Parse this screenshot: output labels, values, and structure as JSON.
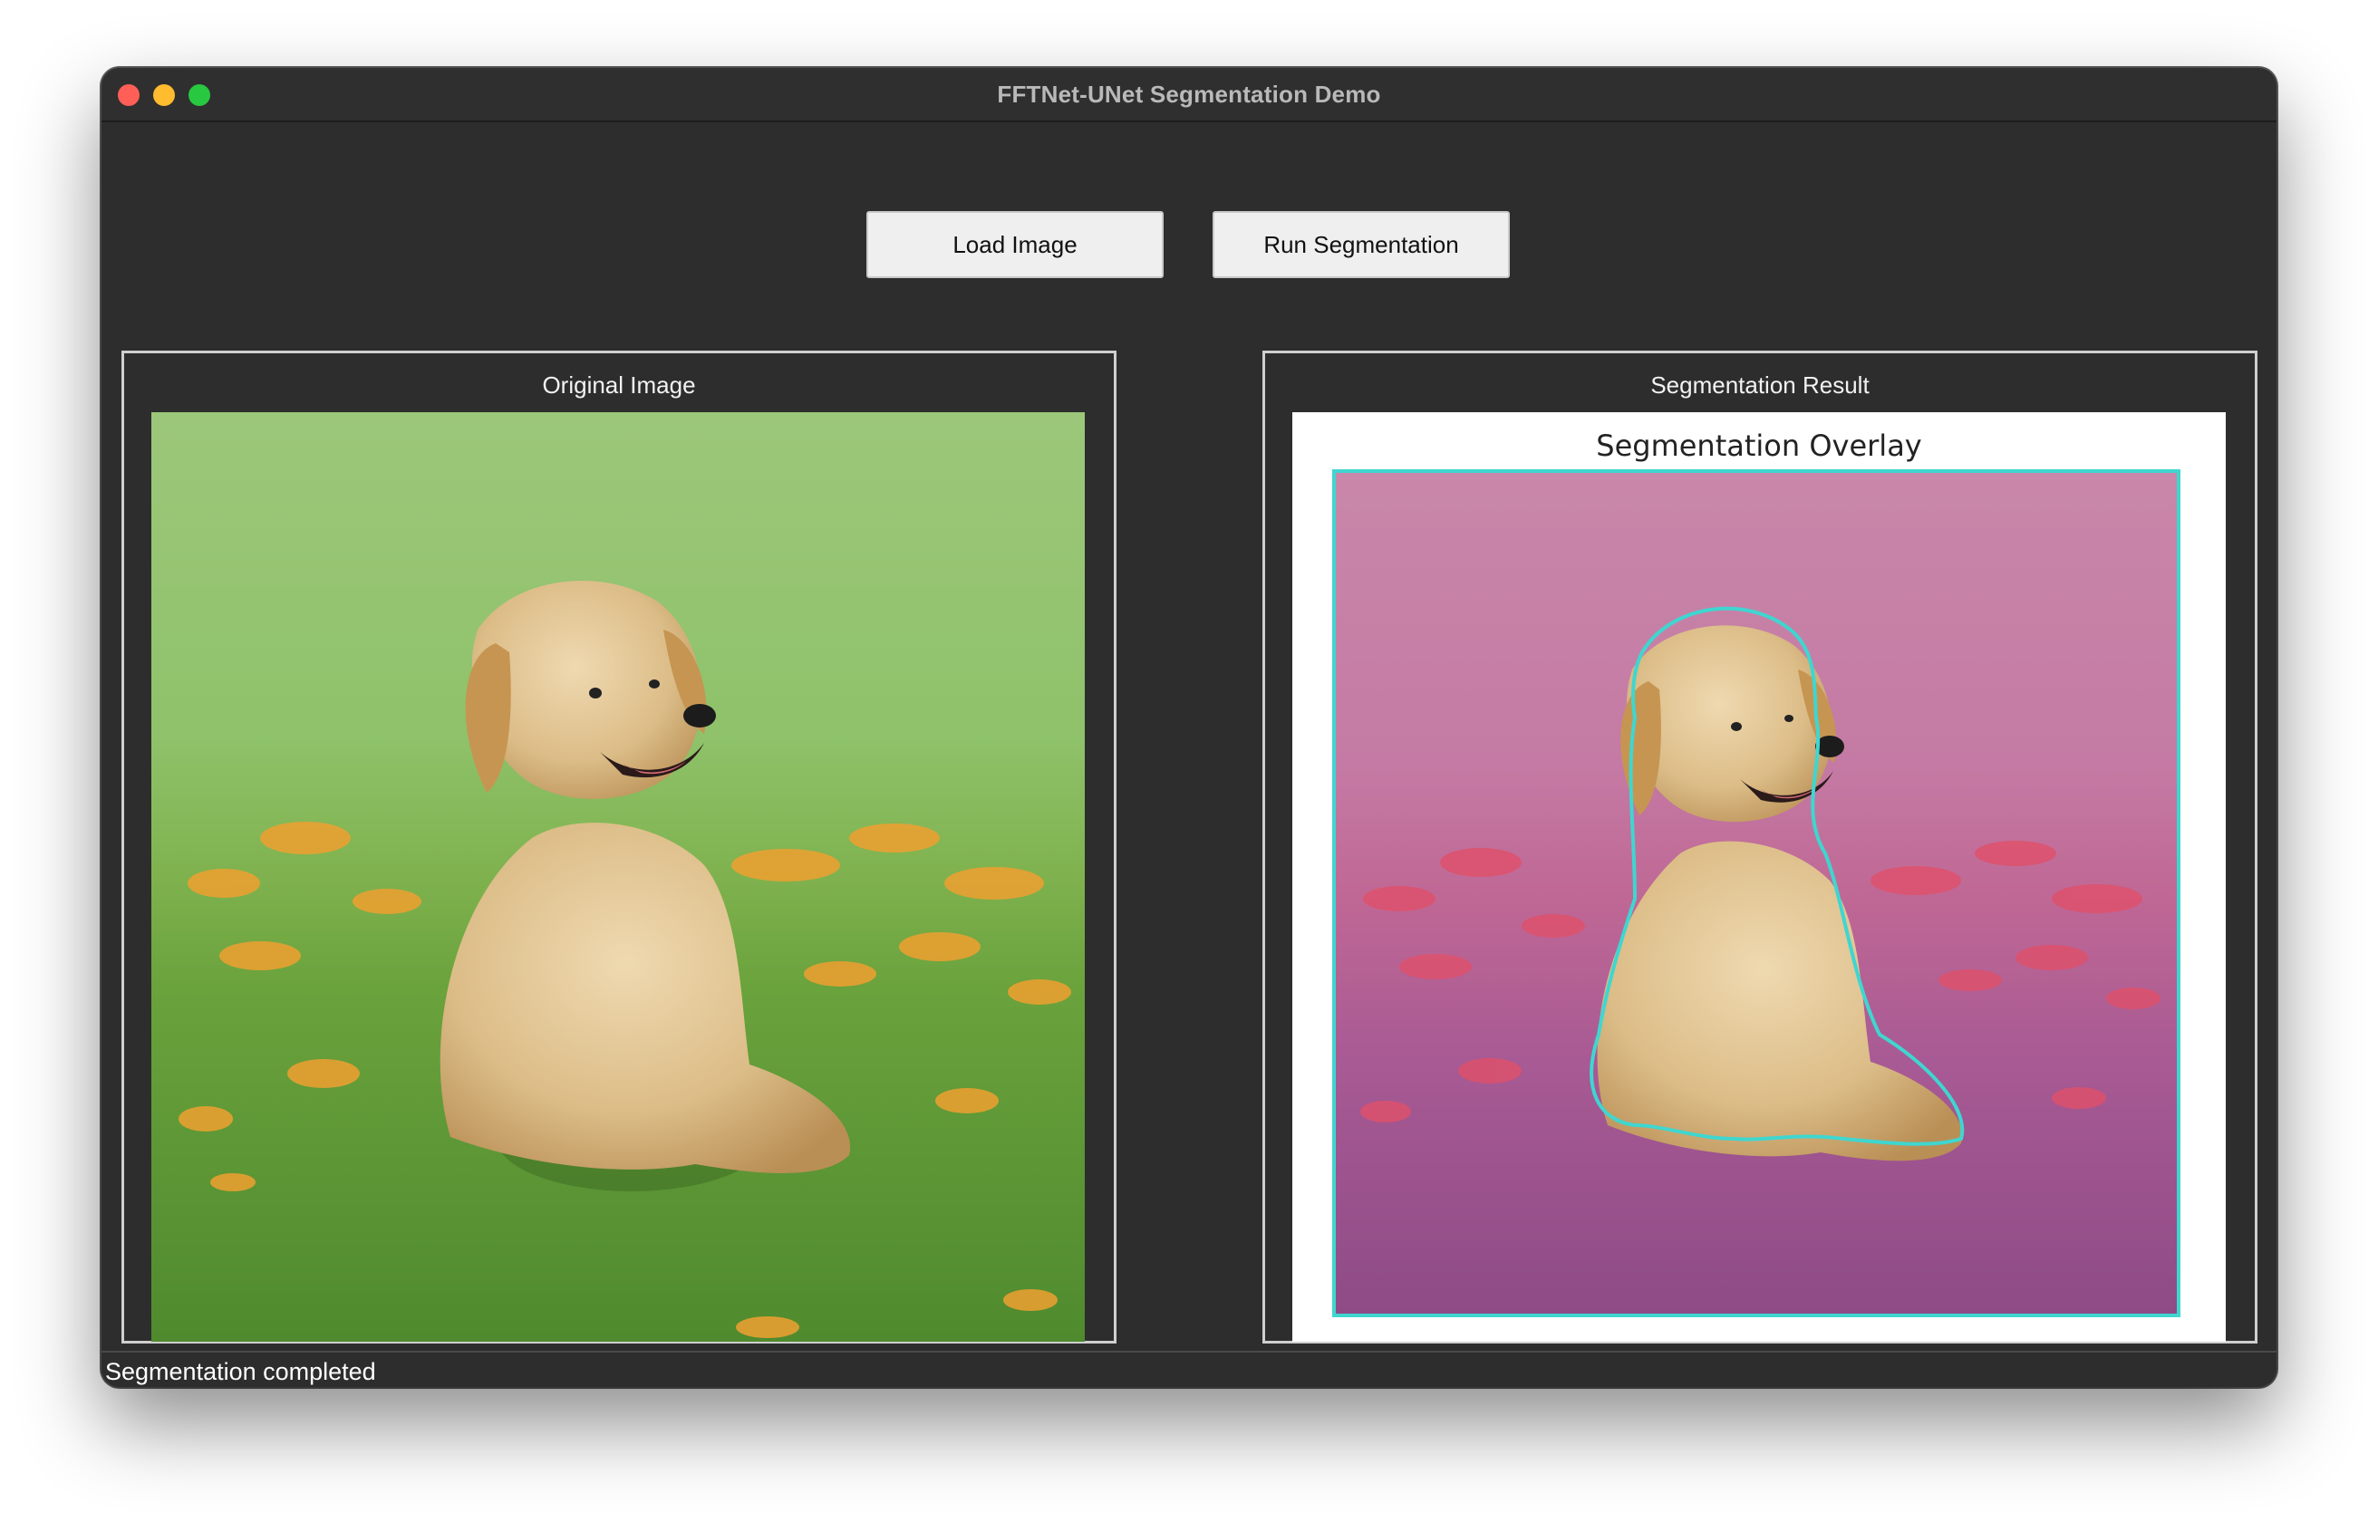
{
  "window": {
    "title": "FFTNet-UNet Segmentation Demo"
  },
  "toolbar": {
    "load_label": "Load Image",
    "run_label": "Run Segmentation"
  },
  "panels": {
    "original": {
      "label": "Original Image"
    },
    "result": {
      "label": "Segmentation Result",
      "figure_title": "Segmentation Overlay"
    }
  },
  "status": {
    "text": "Segmentation completed"
  },
  "colors": {
    "window_bg": "#2d2d2d",
    "overlay_tint": "#c23fa0",
    "contour": "#3fd6d0"
  }
}
